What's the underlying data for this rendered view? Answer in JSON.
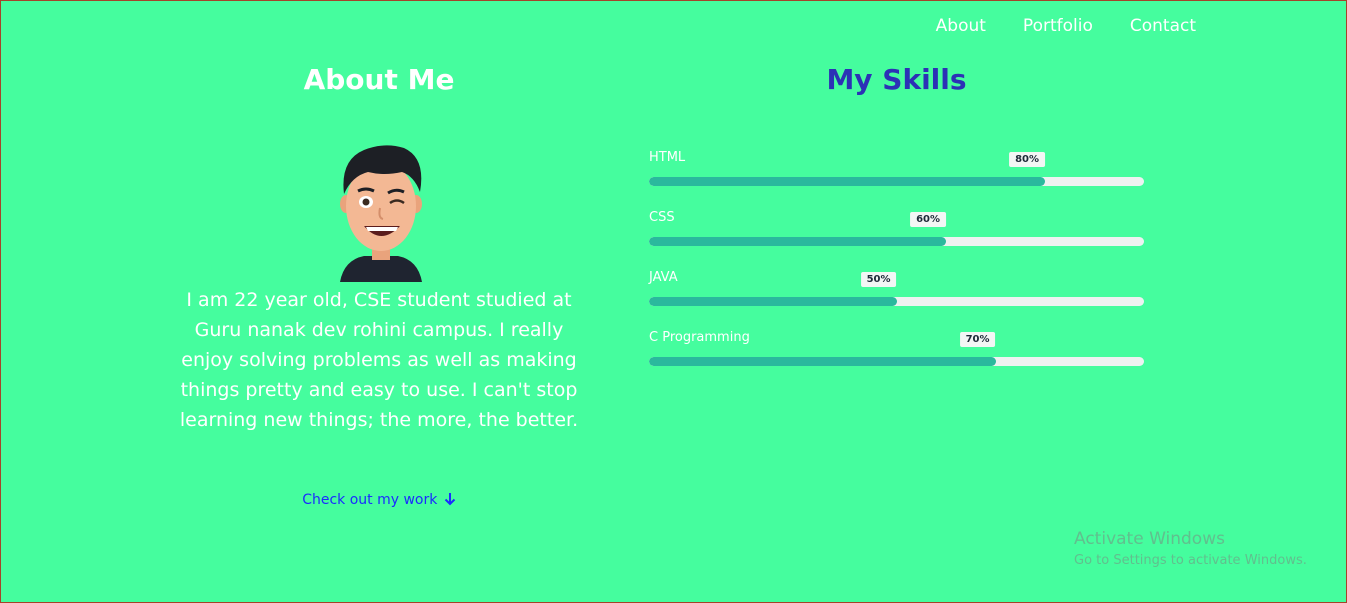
{
  "colors": {
    "page_background": "#45fd9e",
    "skills_heading": "#2c31b6",
    "link": "#1b2bff",
    "bar_fill": "#2ab99d",
    "bar_track": "#eef2f1"
  },
  "nav": {
    "items": [
      {
        "label": "About"
      },
      {
        "label": "Portfolio"
      },
      {
        "label": "Contact"
      }
    ]
  },
  "about": {
    "title": "About Me",
    "avatar_icon": "memoji-avatar-winking",
    "bio": "I am 22 year old, CSE student studied at Guru nanak dev rohini campus. I really enjoy solving problems as well as making things pretty and easy to use. I can't stop learning new things; the more, the better.",
    "cta_label": "Check out my work",
    "cta_icon": "arrow-down-icon"
  },
  "skills": {
    "title": "My Skills",
    "items": [
      {
        "name": "HTML",
        "percent_label": "80%",
        "level": 80
      },
      {
        "name": "CSS",
        "percent_label": "60%",
        "level": 60
      },
      {
        "name": "JAVA",
        "percent_label": "50%",
        "level": 50
      },
      {
        "name": "C Programming",
        "percent_label": "70%",
        "level": 70
      }
    ]
  },
  "watermark": {
    "line1": "Activate Windows",
    "line2": "Go to Settings to activate Windows."
  }
}
